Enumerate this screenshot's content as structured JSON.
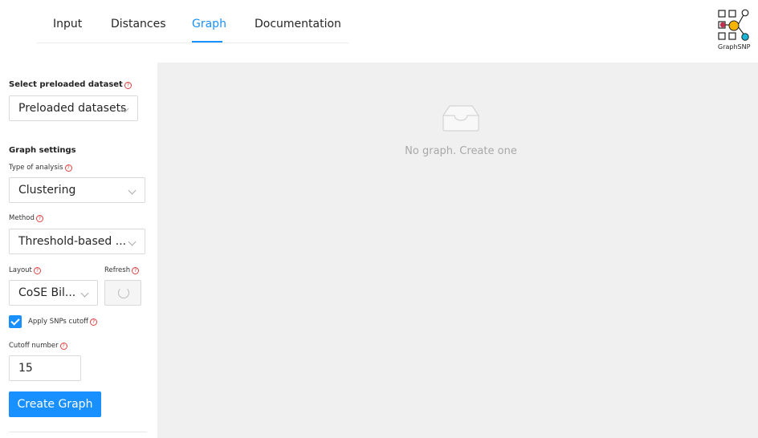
{
  "tabs": [
    {
      "label": "Input"
    },
    {
      "label": "Distances"
    },
    {
      "label": "Graph"
    },
    {
      "label": "Documentation"
    }
  ],
  "active_tab": "Graph",
  "logo": {
    "text": "GraphSNP"
  },
  "sidebar": {
    "preloaded_label": "Select preloaded dataset",
    "preloaded_value": "Preloaded datasets",
    "graph_settings_label": "Graph settings",
    "analysis_label": "Type of analysis",
    "analysis_value": "Clustering",
    "method_label": "Method",
    "method_value": "Threshold-based ...",
    "layout_label": "Layout",
    "layout_value": "CoSE Bil...",
    "refresh_label": "Refresh",
    "snps_cutoff_label": "Apply SNPs cutoff",
    "snps_cutoff_checked": true,
    "cutoff_label": "Cutoff number",
    "cutoff_value": "15",
    "create_button": "Create Graph",
    "help_glyph": "?"
  },
  "content": {
    "empty_text": "No graph. Create one"
  },
  "colors": {
    "accent": "#1890ff",
    "help": "#e04040",
    "content_bg": "#f0f0f0"
  }
}
